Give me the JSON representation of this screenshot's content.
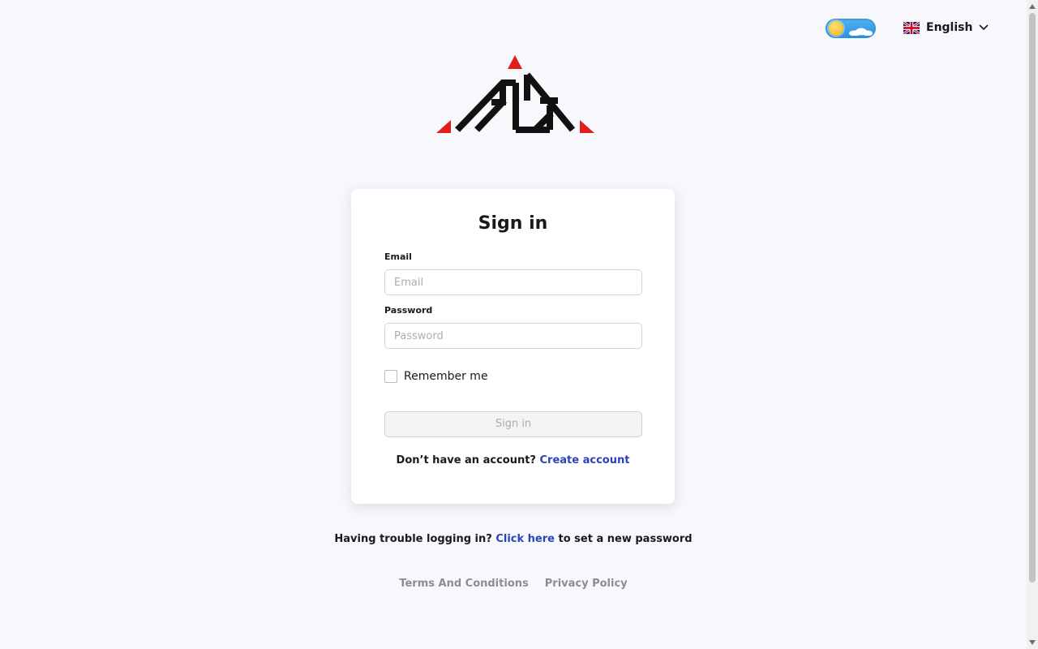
{
  "header": {
    "theme_toggle": {
      "mode": "light",
      "icon": "sun-cloud-icon"
    },
    "language": {
      "label": "English",
      "flag": "uk-flag-icon"
    }
  },
  "logo": {
    "name": "company-logo",
    "colors": {
      "black": "#111111",
      "red": "#e21d1d"
    }
  },
  "signin": {
    "title": "Sign in",
    "email_label": "Email",
    "email_placeholder": "Email",
    "email_value": "",
    "password_label": "Password",
    "password_placeholder": "Password",
    "password_value": "",
    "remember_label": "Remember me",
    "remember_checked": false,
    "submit_label": "Sign in",
    "no_account_text": "Don’t have an account?",
    "create_account_link": "Create account"
  },
  "trouble": {
    "prefix": "Having trouble logging in?",
    "link": "Click here",
    "suffix": "to set a new password"
  },
  "footer": {
    "terms": "Terms And Conditions",
    "privacy": "Privacy Policy"
  },
  "colors": {
    "background": "#f7f8fc",
    "link": "#2b44b8",
    "muted": "#8a8d94"
  }
}
